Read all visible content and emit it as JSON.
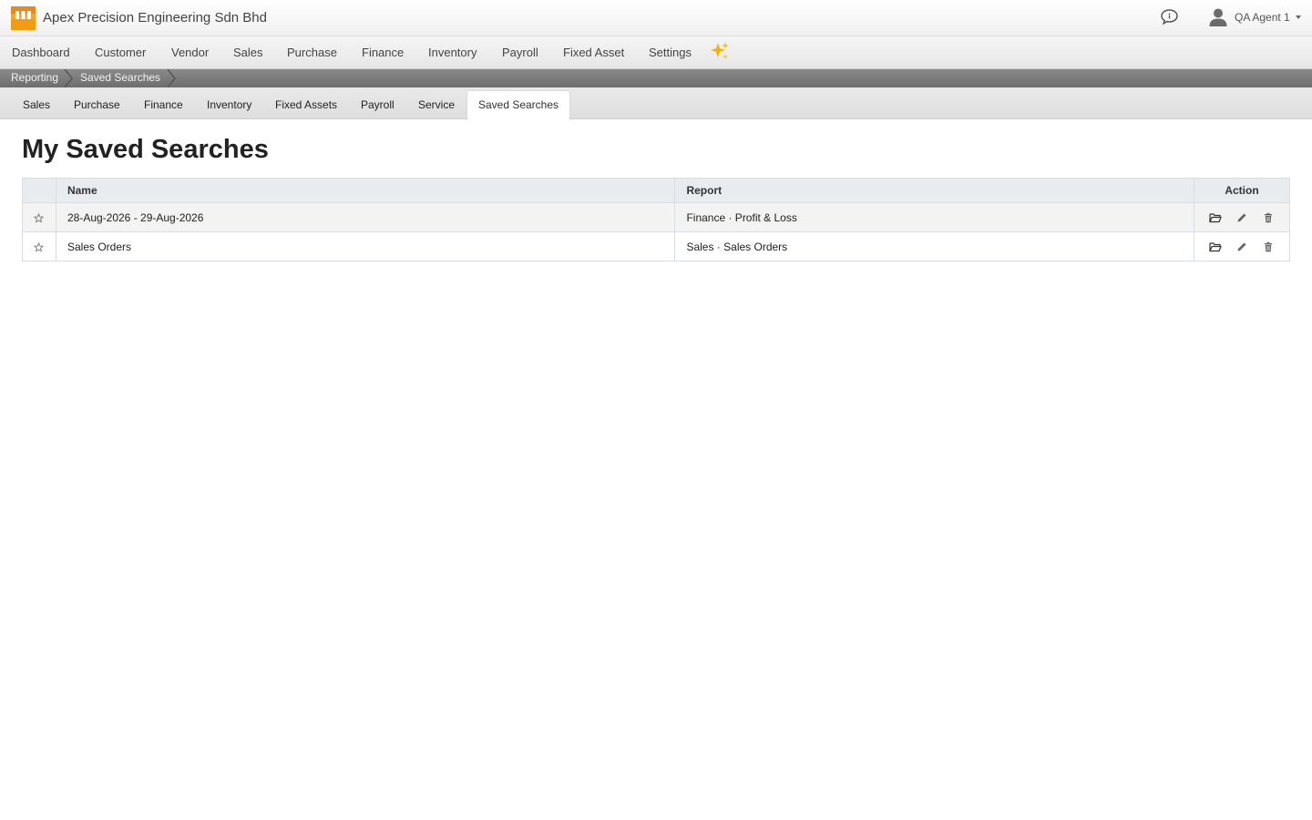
{
  "header": {
    "company_name": "Apex Precision Engineering Sdn Bhd",
    "user_name": "QA Agent 1",
    "icons": [
      "app-logo-icon",
      "chat-icon",
      "user-avatar-icon",
      "chevron-down-icon"
    ]
  },
  "main_nav": {
    "items": [
      "Dashboard",
      "Customer",
      "Vendor",
      "Sales",
      "Purchase",
      "Finance",
      "Inventory",
      "Payroll",
      "Fixed Asset",
      "Settings"
    ],
    "extra_icon": "sparkle-icon"
  },
  "breadcrumb": [
    "Reporting",
    "Saved Searches"
  ],
  "sub_nav": {
    "tabs": [
      "Sales",
      "Purchase",
      "Finance",
      "Inventory",
      "Fixed Assets",
      "Payroll",
      "Service",
      "Saved Searches"
    ],
    "active": "Saved Searches"
  },
  "page": {
    "title": "My Saved Searches"
  },
  "table": {
    "columns": [
      "",
      "Name",
      "Report",
      "Action"
    ],
    "rows": [
      {
        "name": "28-Aug-2026 - 29-Aug-2026",
        "report": "Finance · Profit & Loss"
      },
      {
        "name": "Sales Orders",
        "report": "Sales · Sales Orders"
      }
    ],
    "row_actions": [
      "open-folder-icon",
      "edit-pencil-icon",
      "delete-trash-icon"
    ]
  },
  "colors": {
    "logo_orange": "#f39c12",
    "breadcrumb_bg": "#7a7a7a",
    "header_row_bg": "#e9ecef"
  }
}
